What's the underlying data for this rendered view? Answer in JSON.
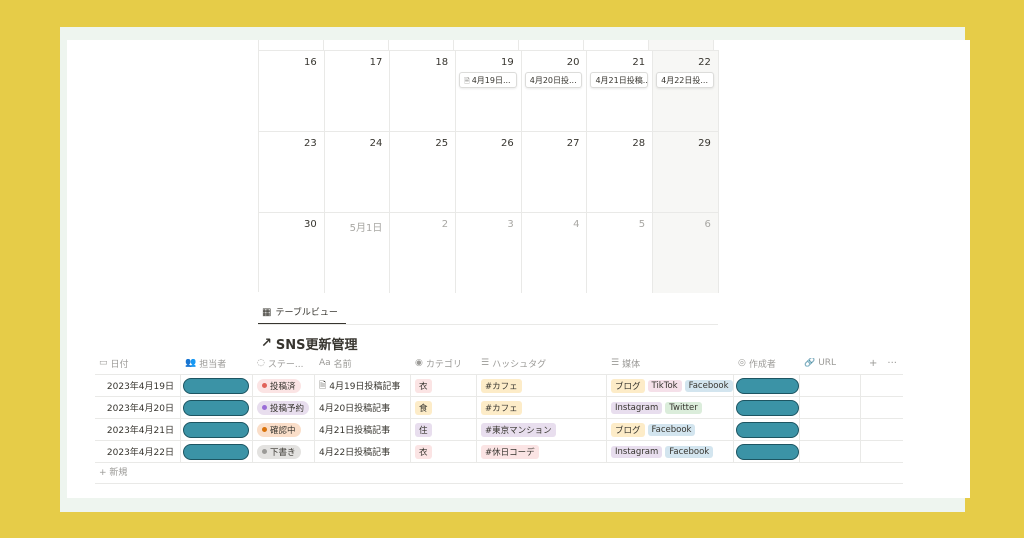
{
  "calendar": {
    "weeks": [
      [
        {
          "date": "16",
          "muted": false,
          "card": ""
        },
        {
          "date": "17",
          "muted": false,
          "card": ""
        },
        {
          "date": "18",
          "muted": false,
          "card": ""
        },
        {
          "date": "19",
          "muted": false,
          "card": "4月19日...",
          "doc_icon": true
        },
        {
          "date": "20",
          "muted": false,
          "card": "4月20日投..."
        },
        {
          "date": "21",
          "muted": false,
          "card": "4月21日投稿..."
        },
        {
          "date": "22",
          "muted": false,
          "card": "4月22日投..."
        }
      ],
      [
        {
          "date": "23",
          "muted": false,
          "card": ""
        },
        {
          "date": "24",
          "muted": false,
          "card": ""
        },
        {
          "date": "25",
          "muted": false,
          "card": ""
        },
        {
          "date": "26",
          "muted": false,
          "card": ""
        },
        {
          "date": "27",
          "muted": false,
          "card": ""
        },
        {
          "date": "28",
          "muted": false,
          "card": ""
        },
        {
          "date": "29",
          "muted": false,
          "card": ""
        }
      ],
      [
        {
          "date": "30",
          "muted": false,
          "card": ""
        },
        {
          "date": "5月1日",
          "muted": true,
          "card": ""
        },
        {
          "date": "2",
          "muted": true,
          "card": ""
        },
        {
          "date": "3",
          "muted": true,
          "card": ""
        },
        {
          "date": "4",
          "muted": true,
          "card": ""
        },
        {
          "date": "5",
          "muted": true,
          "card": ""
        },
        {
          "date": "6",
          "muted": true,
          "card": ""
        }
      ]
    ]
  },
  "view_tab": {
    "label": "テーブルビュー",
    "icon": "table-icon"
  },
  "database": {
    "arrow": "↗",
    "title": "SNS更新管理"
  },
  "table": {
    "columns": [
      {
        "icon": "calendar-icon",
        "glyph": "▭",
        "label": "日付"
      },
      {
        "icon": "people-icon",
        "glyph": "👥",
        "label": "担当者"
      },
      {
        "icon": "status-icon",
        "glyph": "◌",
        "label": "ステー..."
      },
      {
        "icon": "text-icon",
        "glyph": "Aa",
        "label": "名前"
      },
      {
        "icon": "select-icon",
        "glyph": "◉",
        "label": "カテゴリ"
      },
      {
        "icon": "list-icon",
        "glyph": "☰",
        "label": "ハッシュタグ"
      },
      {
        "icon": "list-icon",
        "glyph": "☰",
        "label": "媒体"
      },
      {
        "icon": "person-icon",
        "glyph": "◎",
        "label": "作成者"
      },
      {
        "icon": "link-icon",
        "glyph": "🔗",
        "label": "URL"
      }
    ],
    "add_column": "+",
    "more": "···",
    "rows": [
      {
        "date": "2023年4月19日",
        "status": {
          "label": "投稿済",
          "bg": "#fbe4e4",
          "dot": "#e16259"
        },
        "name": "4月19日投稿記事",
        "name_doc_icon": true,
        "category": {
          "label": "衣",
          "bg": "#fbe4e4"
        },
        "hashtag": {
          "label": "#カフェ",
          "bg": "#fdecc8"
        },
        "media": [
          {
            "label": "ブログ",
            "bg": "#fdecc8"
          },
          {
            "label": "TikTok",
            "bg": "#f5e0e9"
          },
          {
            "label": "Facebook",
            "bg": "#d3e5ef"
          }
        ]
      },
      {
        "date": "2023年4月20日",
        "status": {
          "label": "投稿予約",
          "bg": "#e8deee",
          "dot": "#9a6dd7"
        },
        "name": "4月20日投稿記事",
        "name_doc_icon": false,
        "category": {
          "label": "食",
          "bg": "#fdecc8"
        },
        "hashtag": {
          "label": "#カフェ",
          "bg": "#fdecc8"
        },
        "media": [
          {
            "label": "Instagram",
            "bg": "#e8deee"
          },
          {
            "label": "Twitter",
            "bg": "#dbeddb"
          }
        ]
      },
      {
        "date": "2023年4月21日",
        "status": {
          "label": "確認中",
          "bg": "#fadec9",
          "dot": "#d9730d"
        },
        "name": "4月21日投稿記事",
        "name_doc_icon": false,
        "category": {
          "label": "住",
          "bg": "#e8deee"
        },
        "hashtag": {
          "label": "#東京マンション",
          "bg": "#e8deee"
        },
        "media": [
          {
            "label": "ブログ",
            "bg": "#fdecc8"
          },
          {
            "label": "Facebook",
            "bg": "#d3e5ef"
          }
        ]
      },
      {
        "date": "2023年4月22日",
        "status": {
          "label": "下書き",
          "bg": "#e3e2e0",
          "dot": "#9b9a97"
        },
        "name": "4月22日投稿記事",
        "name_doc_icon": false,
        "category": {
          "label": "衣",
          "bg": "#fbe4e4"
        },
        "hashtag": {
          "label": "#休日コーデ",
          "bg": "#fbe4e4"
        },
        "media": [
          {
            "label": "Instagram",
            "bg": "#e8deee"
          },
          {
            "label": "Facebook",
            "bg": "#d3e5ef"
          }
        ]
      }
    ],
    "new_row_label": "+ 新規"
  },
  "colors": {
    "background": "#e6cc48",
    "redaction": "#3b93a6"
  }
}
